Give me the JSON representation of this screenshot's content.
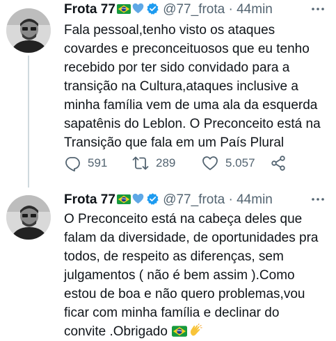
{
  "tweets": [
    {
      "author": {
        "name": "Frota 77",
        "handle": "@77_frota",
        "separator": "·",
        "time": "44min"
      },
      "lines": [
        "Fala pessoal,tenho visto os ataques",
        "covardes e preconceituosos que eu tenho",
        "recebido por ter sido convidado para a",
        "transição na Cultura,ataques inclusive a",
        "minha família vem de uma ala da esquerda",
        "sapatênis do Leblon. O Preconceito está na",
        "Transição que fala em um País Plural"
      ],
      "stats": {
        "replies": "591",
        "retweets": "289",
        "likes": "5.057"
      }
    },
    {
      "author": {
        "name": "Frota 77",
        "handle": "@77_frota",
        "separator": "·",
        "time": "44min"
      },
      "lines": [
        "O Preconceito está na cabeça deles que",
        "falam da diversidade, de oportunidades pra",
        "todos, de respeito as diferenças, sem",
        "julgamentos ( não é bem assim ).Como",
        "estou de boa e não quero problemas,vou",
        "ficar com minha família e declinar do",
        "convite .Obrigado"
      ]
    }
  ],
  "icons": {
    "more": "more-icon",
    "verified": "verified-badge-icon",
    "flag": "brazil-flag-icon",
    "heart_emoji": "blue-heart-icon",
    "reply": "reply-icon",
    "retweet": "retweet-icon",
    "like": "like-icon",
    "share": "share-icon",
    "clap": "clapping-hands-icon"
  },
  "colors": {
    "text": "#0f1419",
    "muted": "#536471",
    "verified": "#1d9bf0",
    "thread_line": "#cfd9de"
  }
}
